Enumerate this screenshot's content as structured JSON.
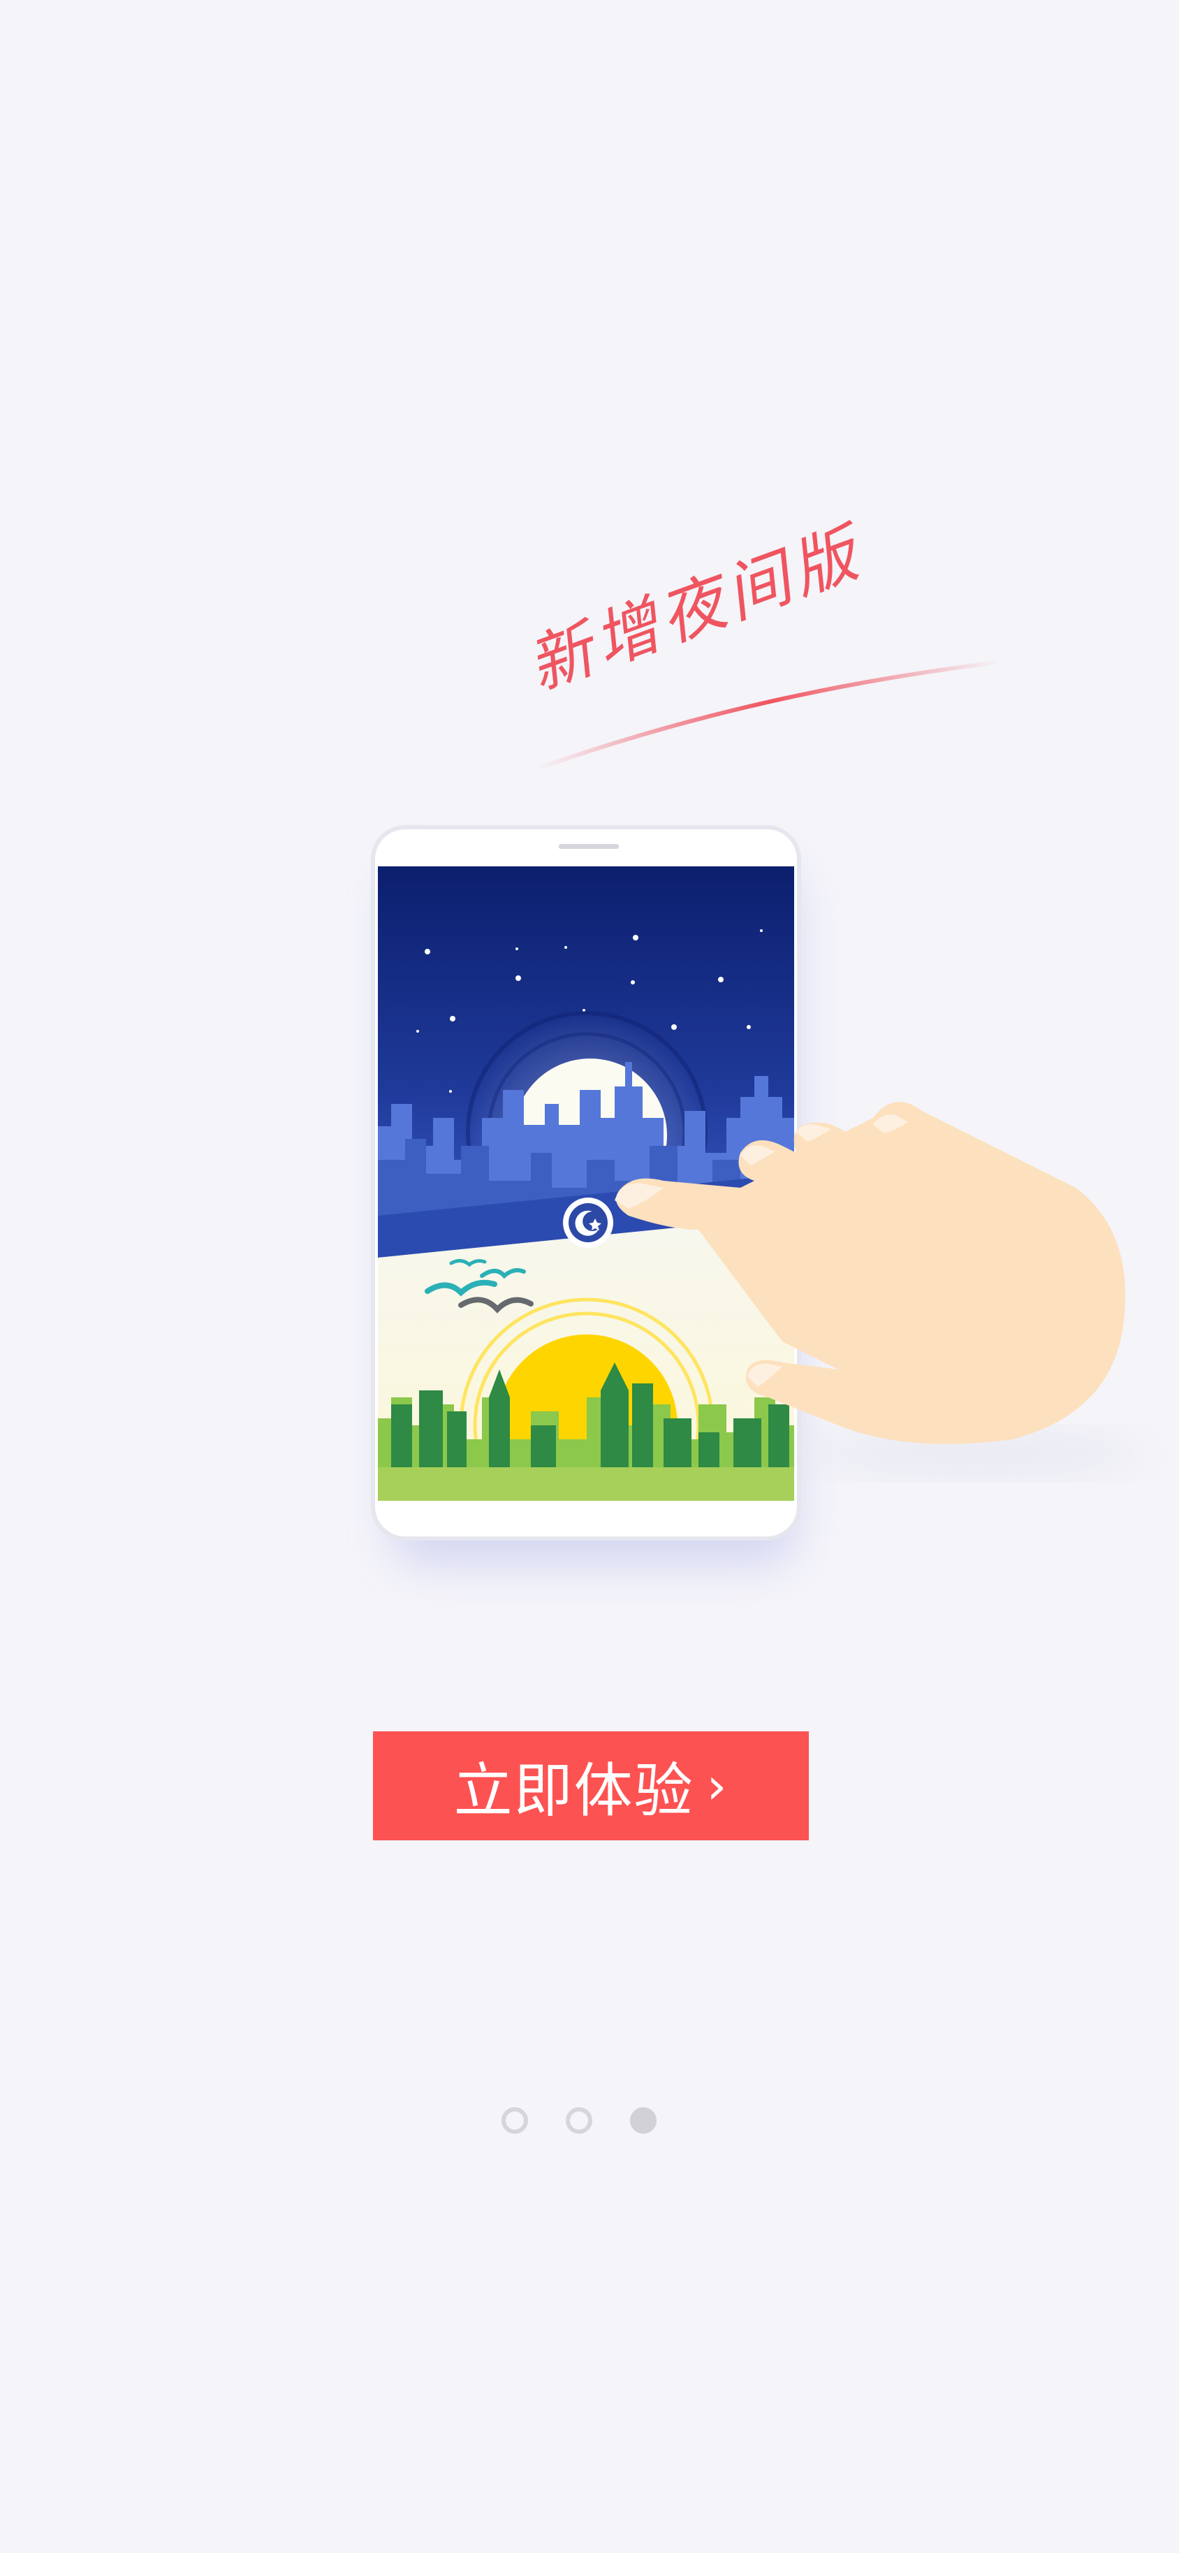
{
  "headline": "新增夜间版",
  "cta": {
    "label": "立即体验",
    "chevron": "›"
  },
  "pager": {
    "total": 3,
    "active_index": 2
  },
  "colors": {
    "background": "#f4f4f9",
    "accent": "#fd5252",
    "headline": "#ef5560",
    "night_sky": "#1b2c82",
    "day_grass": "#8cc84b",
    "sun": "#ffd500",
    "hand": "#fde0bd"
  },
  "icons": [
    "moon-star-icon"
  ]
}
